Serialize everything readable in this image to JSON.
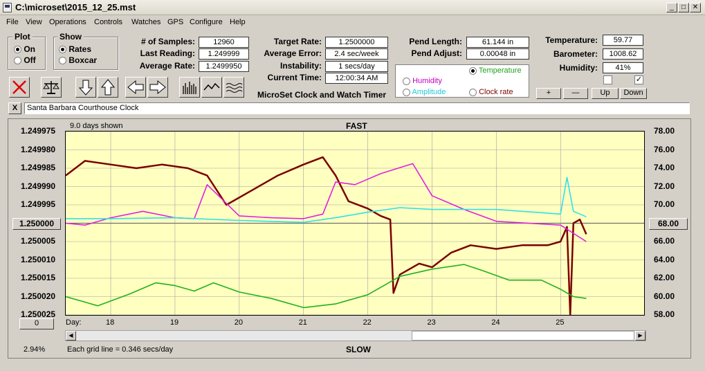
{
  "window": {
    "title": "C:\\microset\\2015_12_25.mst"
  },
  "menu": [
    "File",
    "View",
    "Operations",
    "Controls",
    "Watches",
    "GPS",
    "Configure",
    "Help"
  ],
  "plot_group": {
    "title": "Plot",
    "options": [
      "On",
      "Off"
    ],
    "selected": "On"
  },
  "show_group": {
    "title": "Show",
    "options": [
      "Rates",
      "Boxcar"
    ],
    "selected": "Rates"
  },
  "stats": {
    "samples_label": "# of Samples:",
    "samples": "12960",
    "last_label": "Last Reading:",
    "last": "1.249999",
    "avg_rate_label": "Average Rate:",
    "avg_rate": "1.2499950",
    "target_label": "Target Rate:",
    "target": "1.2500000",
    "avg_err_label": "Average Error:",
    "avg_err": "2.4 sec/week",
    "instab_label": "Instability:",
    "instab": "1 secs/day",
    "time_label": "Current Time:",
    "time": "12:00:34 AM",
    "pend_len_label": "Pend Length:",
    "pend_len": "61.144 in",
    "pend_adj_label": "Pend Adjust:",
    "pend_adj": "0.00048 in",
    "temp_label": "Temperature:",
    "temp": "59.77",
    "baro_label": "Barometer:",
    "baro": "1008.62",
    "hum_label": "Humidity:",
    "hum": "41%"
  },
  "app_name": "MicroSet Clock and Watch Timer",
  "sensor_options": {
    "temperature": "Temperature",
    "humidity": "Humidity",
    "amplitude": "Amplitude",
    "clock_rate": "Clock rate",
    "selected": "Temperature"
  },
  "sensor_buttons": {
    "plus": "+",
    "minus": "—",
    "up": "Up",
    "down": "Down"
  },
  "checkboxes": [
    false,
    true
  ],
  "clock_name": "Santa Barbara Courthouse Clock",
  "clear_label": "X",
  "chart_header": {
    "days_shown": "9.0 days shown",
    "fast": "FAST",
    "slow": "SLOW",
    "grid_note": "Each grid line = 0.346 secs/day",
    "percent": "2.94%",
    "day_label": "Day:"
  },
  "left_value_box": "1.250000",
  "right_value_box": "68.00",
  "zoom_box": "0",
  "colors": {
    "rate": "#7a0000",
    "humidity": "#e020e0",
    "amplitude": "#30e0e8",
    "temperature": "#20b020",
    "plot_bg": "#ffffc0",
    "grid": "#a0a0a0"
  },
  "icons": [
    "close-x-icon",
    "balance-icon",
    "arrow-down-icon",
    "arrow-up-icon",
    "arrow-left-icon",
    "arrow-right-icon",
    "histogram-icon",
    "line-wave-icon",
    "multi-wave-icon"
  ],
  "chart_data": {
    "type": "line",
    "x_label": "Day",
    "xlim": [
      17.3,
      26.3
    ],
    "x_ticks": [
      18,
      19,
      20,
      21,
      22,
      23,
      24,
      25
    ],
    "y_left_ticks": [
      "1.249975",
      "1.249980",
      "1.249985",
      "1.249990",
      "1.249995",
      "1.250000",
      "1.250005",
      "1.250010",
      "1.250015",
      "1.250020",
      "1.250025"
    ],
    "y_left_range": [
      1.249975,
      1.250025
    ],
    "y_right_ticks": [
      "78.00",
      "76.00",
      "74.00",
      "72.00",
      "70.00",
      "68.00",
      "66.00",
      "64.00",
      "62.00",
      "60.00",
      "58.00"
    ],
    "y_right_range": [
      58,
      78
    ],
    "series": [
      {
        "name": "Clock rate",
        "axis": "left",
        "color": "#7a0000",
        "x": [
          17.3,
          17.6,
          18.0,
          18.4,
          18.8,
          19.2,
          19.5,
          19.8,
          20.2,
          20.6,
          21.0,
          21.3,
          21.5,
          21.7,
          22.0,
          22.2,
          22.35,
          22.4,
          22.5,
          22.8,
          23.0,
          23.3,
          23.6,
          24.0,
          24.4,
          24.8,
          25.0,
          25.1,
          25.15,
          25.2,
          25.3,
          25.4
        ],
        "y": [
          1.249987,
          1.249983,
          1.249984,
          1.249985,
          1.249984,
          1.249985,
          1.249987,
          1.249995,
          1.249991,
          1.249987,
          1.249984,
          1.249982,
          1.249987,
          1.249994,
          1.249996,
          1.249998,
          1.249999,
          1.250019,
          1.250014,
          1.250011,
          1.250012,
          1.250008,
          1.250006,
          1.250007,
          1.250006,
          1.250006,
          1.250005,
          1.250001,
          1.250025,
          1.25,
          1.249999,
          1.250003
        ]
      },
      {
        "name": "Humidity",
        "axis": "right",
        "color": "#e020e0",
        "x": [
          17.3,
          17.6,
          18.0,
          18.5,
          19.0,
          19.3,
          19.5,
          20.0,
          20.5,
          21.0,
          21.3,
          21.5,
          21.8,
          22.2,
          22.7,
          23.0,
          23.5,
          24.0,
          24.5,
          25.0,
          25.4
        ],
        "y": [
          68.0,
          67.8,
          68.6,
          69.3,
          68.6,
          68.5,
          72.2,
          68.8,
          68.6,
          68.5,
          69.0,
          72.5,
          72.2,
          73.4,
          74.5,
          71.0,
          69.5,
          68.2,
          68.0,
          67.8,
          66.0
        ]
      },
      {
        "name": "Amplitude",
        "axis": "right",
        "color": "#30e0e8",
        "x": [
          17.3,
          18.0,
          19.0,
          20.0,
          21.0,
          21.5,
          22.0,
          22.5,
          23.0,
          24.0,
          25.0,
          25.1,
          25.2,
          25.4
        ],
        "y": [
          68.5,
          68.5,
          68.6,
          68.3,
          68.1,
          68.6,
          69.2,
          69.7,
          69.5,
          69.5,
          69.0,
          73.0,
          69.3,
          68.7
        ]
      },
      {
        "name": "Temperature",
        "axis": "right",
        "color": "#20b020",
        "x": [
          17.3,
          17.8,
          18.3,
          18.7,
          19.0,
          19.3,
          19.6,
          20.0,
          20.5,
          21.0,
          21.5,
          22.0,
          22.5,
          23.0,
          23.5,
          23.8,
          24.2,
          24.7,
          25.0,
          25.2,
          25.4
        ],
        "y": [
          60.0,
          59.0,
          60.3,
          61.5,
          61.2,
          60.6,
          61.5,
          60.5,
          59.8,
          58.8,
          59.2,
          60.2,
          62.2,
          63.0,
          63.5,
          62.8,
          61.8,
          61.8,
          60.8,
          60.0,
          59.8
        ]
      }
    ]
  }
}
